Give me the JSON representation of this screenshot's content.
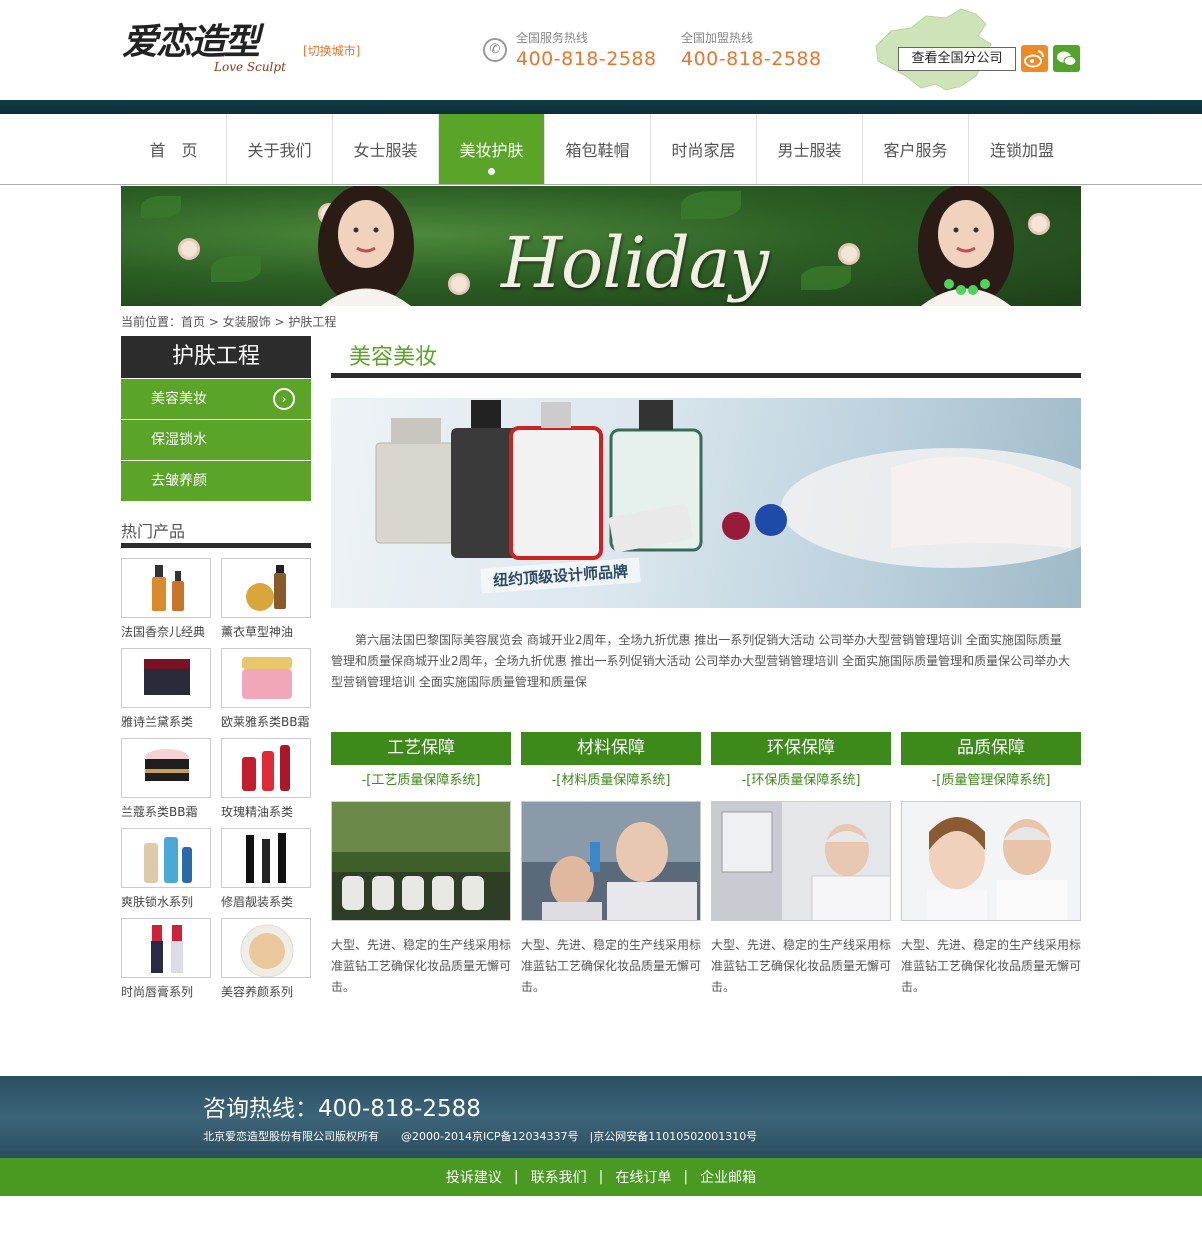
{
  "header": {
    "logo_cn": "爱恋造型",
    "logo_en": "Love Sculpt",
    "switch_city": "[切换城市]",
    "hotline_service": {
      "label": "全国服务热线",
      "number": "400-818-2588"
    },
    "hotline_join": {
      "label": "全国加盟热线",
      "number": "400-818-2588"
    },
    "branch_button": "查看全国分公司",
    "weibo_icon": "weibo-icon",
    "wechat_icon": "wechat-icon"
  },
  "nav": {
    "items": [
      {
        "label": "首　页"
      },
      {
        "label": "关于我们"
      },
      {
        "label": "女士服装"
      },
      {
        "label": "美妆护肤"
      },
      {
        "label": "箱包鞋帽"
      },
      {
        "label": "时尚家居"
      },
      {
        "label": "男士服装"
      },
      {
        "label": "客户服务"
      },
      {
        "label": "连锁加盟"
      }
    ],
    "active_index": 3
  },
  "banner": {
    "text": "Holiday"
  },
  "breadcrumb": "当前位置：首页 > 女装服饰 > 护肤工程",
  "sidebar": {
    "title": "护肤工程",
    "items": [
      {
        "label": "美容美妆"
      },
      {
        "label": "保湿锁水"
      },
      {
        "label": "去皱养颜"
      }
    ],
    "hot_title": "热门产品",
    "hot_products": [
      {
        "name": "法国香奈儿经典"
      },
      {
        "name": "薰衣草型神油"
      },
      {
        "name": "雅诗兰黛系类"
      },
      {
        "name": "欧莱雅系类BB霜"
      },
      {
        "name": "兰蔻系类BB霜"
      },
      {
        "name": "玫瑰精油系类"
      },
      {
        "name": "爽肤锁水系列"
      },
      {
        "name": "修眉靓装系类"
      },
      {
        "name": "时尚唇膏系列"
      },
      {
        "name": "美容养颜系列"
      }
    ]
  },
  "main": {
    "title": "美容美妆",
    "banner_tagline": "纽约顶级设计师品牌",
    "intro": "第六届法国巴黎国际美容展览会 商城开业2周年，全场九折优惠 推出一系列促销大活动 公司举办大型营销管理培训 全面实施国际质量管理和质量保商城开业2周年，全场九折优惠 推出一系列促销大活动 公司举办大型营销管理培训 全面实施国际质量管理和质量保公司举办大型营销管理培训 全面实施国际质量管理和质量保",
    "features": [
      {
        "title": "工艺保障",
        "sub": "-[工艺质量保障系统]",
        "desc": "大型、先进、稳定的生产线采用标准蓝钻工艺确保化妆品质量无懈可击。"
      },
      {
        "title": "材料保障",
        "sub": "-[材料质量保障系统]",
        "desc": "大型、先进、稳定的生产线采用标准蓝钻工艺确保化妆品质量无懈可击。"
      },
      {
        "title": "环保保障",
        "sub": "-[环保质量保障系统]",
        "desc": "大型、先进、稳定的生产线采用标准蓝钻工艺确保化妆品质量无懈可击。"
      },
      {
        "title": "品质保障",
        "sub": "-[质量管理保障系统]",
        "desc": "大型、先进、稳定的生产线采用标准蓝钻工艺确保化妆品质量无懈可击。"
      }
    ]
  },
  "footer": {
    "hotline": "咨询热线：400-818-2588",
    "copyright": "北京爱恋造型股份有限公司版权所有　　@2000-2014京ICP备12034337号　|京公网安备11010502001310号",
    "links": [
      {
        "label": "投诉建议"
      },
      {
        "label": "联系我们"
      },
      {
        "label": "在线订单"
      },
      {
        "label": "企业邮箱"
      }
    ]
  },
  "colors": {
    "accent_green": "#5aa427",
    "dark_green": "#3d8a1a",
    "orange": "#e8762c",
    "dark": "#2c2c2c"
  }
}
